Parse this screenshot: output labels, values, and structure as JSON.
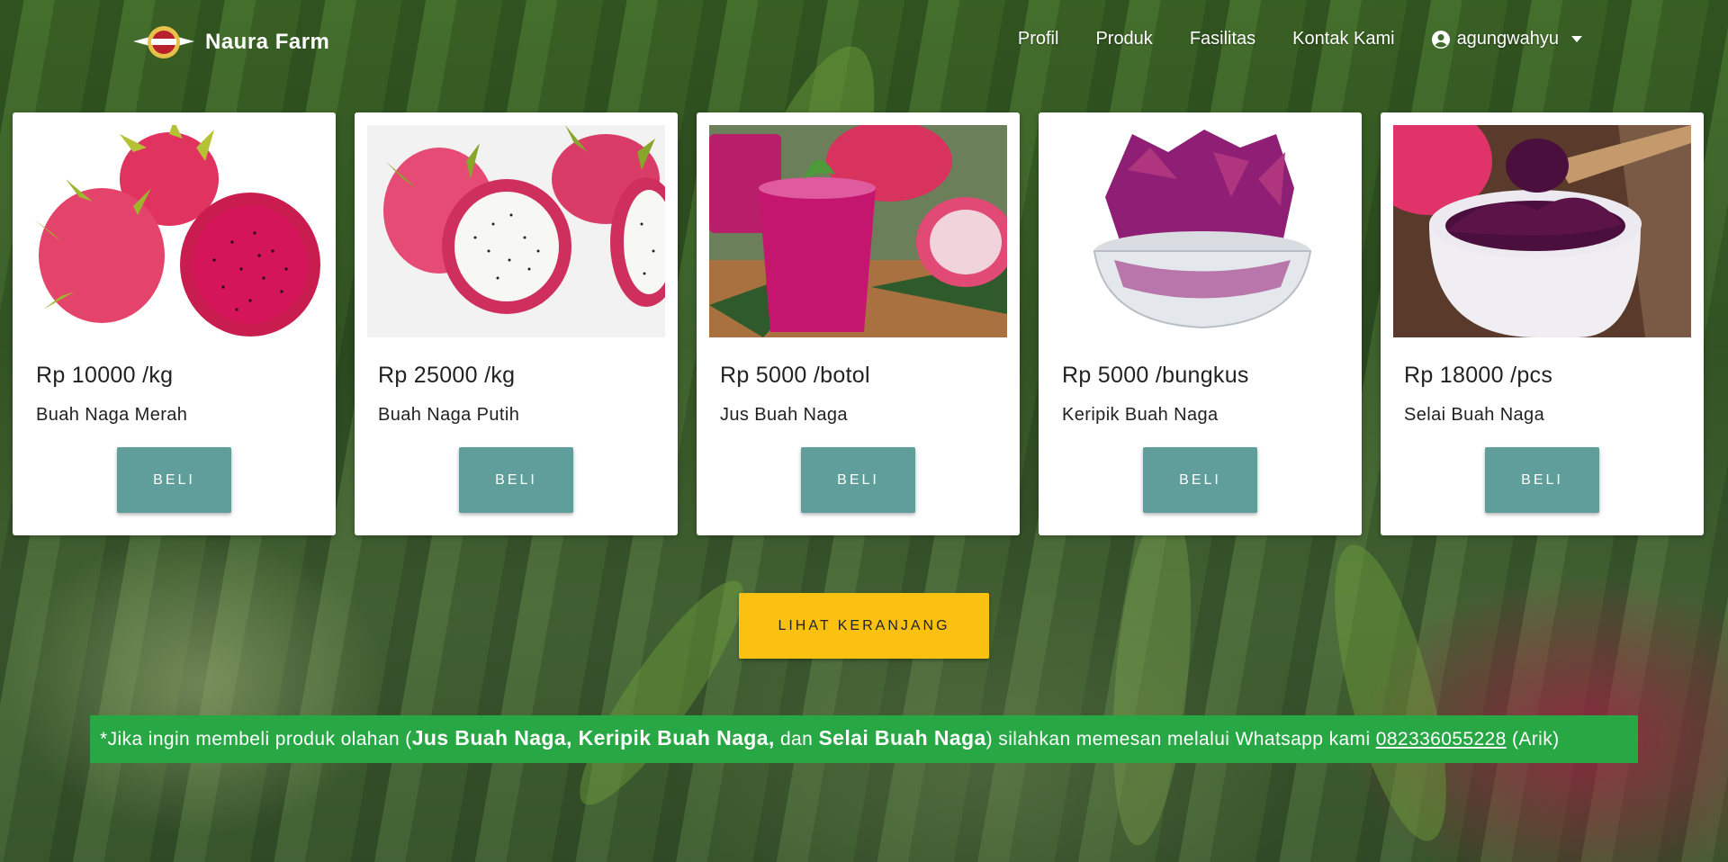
{
  "navbar": {
    "brand": "Naura Farm",
    "links": [
      "Profil",
      "Produk",
      "Fasilitas",
      "Kontak Kami"
    ],
    "user": "agungwahyu",
    "user_icon": "user-circle-icon",
    "caret_icon": "caret-down-icon"
  },
  "products": [
    {
      "price": "Rp 10000 /kg",
      "name": "Buah Naga Merah",
      "button": "BELI",
      "image": "red-dragon-fruit-image"
    },
    {
      "price": "Rp 25000 /kg",
      "name": "Buah Naga Putih",
      "button": "BELI",
      "image": "white-dragon-fruit-image"
    },
    {
      "price": "Rp 5000 /botol",
      "name": "Jus Buah Naga",
      "button": "BELI",
      "image": "dragon-fruit-juice-image"
    },
    {
      "price": "Rp 5000 /bungkus",
      "name": "Keripik Buah Naga",
      "button": "BELI",
      "image": "dragon-fruit-chips-image"
    },
    {
      "price": "Rp 18000 /pcs",
      "name": "Selai Buah Naga",
      "button": "BELI",
      "image": "dragon-fruit-jam-image"
    }
  ],
  "cart_button": "LIHAT KERANJANG",
  "notice": {
    "prefix": "*Jika ingin membeli produk olahan (",
    "bold1": "Jus Buah Naga, Keripik Buah Naga,",
    "mid": " dan ",
    "bold2": "Selai Buah Naga",
    "suffix": ") silahkan memesan melalui Whatsapp kami ",
    "phone": "082336055228",
    "end": " (Arik)"
  },
  "colors": {
    "buy_button": "#5f9e9a",
    "cart_button": "#fbc111",
    "notice_bg": "#28a745"
  }
}
